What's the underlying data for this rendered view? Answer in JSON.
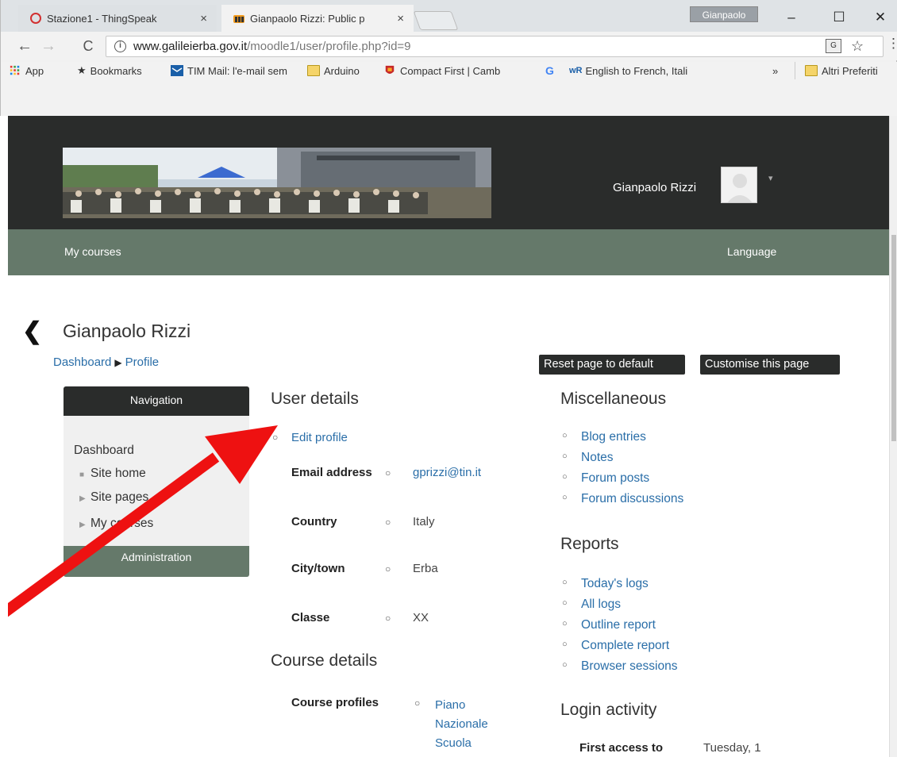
{
  "browser": {
    "tabs": [
      {
        "title": "Stazione1 - ThingSpeak",
        "close": "×"
      },
      {
        "title": "Gianpaolo Rizzi: Public p",
        "close": "×"
      }
    ],
    "profile_name": "Gianpaolo",
    "window_controls": {
      "minimize": "–",
      "maximize": "☐",
      "close": "✕"
    },
    "nav": {
      "back": "←",
      "forward": "→",
      "reload": "C",
      "info": "i"
    },
    "url": {
      "host": "www.galileierba.gov.it",
      "path": "/moodle1/user/profile.php?id=9"
    },
    "bookmarks": [
      {
        "label": "App",
        "icon": "apps-grid-icon"
      },
      {
        "label": "Bookmarks",
        "icon": "star-icon"
      },
      {
        "label": "TIM Mail: l'e-mail sem",
        "icon": "mail-icon"
      },
      {
        "label": "Arduino",
        "icon": "folder-icon"
      },
      {
        "label": "Compact First | Camb",
        "icon": "crest-icon"
      },
      {
        "label": "",
        "icon": "google-icon"
      },
      {
        "label": "English to French, Itali",
        "icon": "wordreference-icon"
      }
    ],
    "bookmarks_more": "»",
    "other_bookmarks": "Altri Preferiti"
  },
  "header": {
    "user_name": "Gianpaolo Rizzi",
    "caret": "▾"
  },
  "navbar": {
    "my_courses": "My courses",
    "language": "Language"
  },
  "page": {
    "back": "❮",
    "title": "Gianpaolo Rizzi",
    "breadcrumb": {
      "dashboard": "Dashboard",
      "sep": "▶",
      "profile": "Profile"
    },
    "reset_button": "Reset page to default",
    "customise_button": "Customise this page"
  },
  "nav_block": {
    "title": "Navigation",
    "dashboard": "Dashboard",
    "site_home": "Site home",
    "site_pages": "Site pages",
    "my_courses": "My courses",
    "admin_title": "Administration",
    "bullet_square": "■",
    "bullet_triangle": "▶"
  },
  "user_details": {
    "title": "User details",
    "bullet": "○",
    "edit_profile": "Edit profile",
    "fields": {
      "email_label": "Email address",
      "email_value": "gprizzi@tin.it",
      "country_label": "Country",
      "country_value": "Italy",
      "city_label": "City/town",
      "city_value": "Erba",
      "classe_label": "Classe",
      "classe_value": "XX"
    }
  },
  "course_details": {
    "title": "Course details",
    "profiles_label": "Course profiles",
    "profiles_value_1": "Piano",
    "profiles_value_2": "Nazionale",
    "profiles_value_3": "Scuola"
  },
  "miscellaneous": {
    "title": "Miscellaneous",
    "items": [
      "Blog entries",
      "Notes",
      "Forum posts",
      "Forum discussions"
    ]
  },
  "reports": {
    "title": "Reports",
    "items": [
      "Today's logs",
      "All logs",
      "Outline report",
      "Complete report",
      "Browser sessions"
    ]
  },
  "login_activity": {
    "title": "Login activity",
    "first_access_label": "First access to",
    "first_access_value": "Tuesday, 1"
  },
  "colors": {
    "header_bg": "#2a2c2b",
    "navbar_bg": "#65796a",
    "link": "#2a6ea8",
    "annotation_arrow": "#ee1111"
  }
}
